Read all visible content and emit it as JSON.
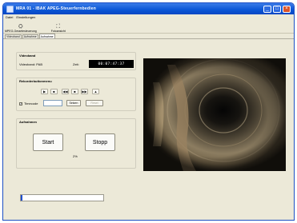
{
  "window": {
    "title": "MRA 01 - IBAK APEG-Steuerfernbedien",
    "controls": {
      "minimize": "_",
      "maximize": "□",
      "close": "×"
    }
  },
  "menu": [
    "Datei",
    "Einstellungen"
  ],
  "toolbar": [
    {
      "label": "MPEG-Geraetesteuerung",
      "icon": "camera-icon"
    },
    {
      "label": "Fotoansicht",
      "icon": "photo-icon"
    }
  ],
  "tabs": [
    {
      "label": "Videoband",
      "active": false
    },
    {
      "label": "Aufnahme",
      "active": false
    },
    {
      "label": "Aufnahme",
      "active": true
    }
  ],
  "video_section": {
    "title": "Videoband",
    "videoband_label": "Videoband: PAB",
    "zeit_label": "Zeit:",
    "zeit_value": "00:07:47:37"
  },
  "recorder": {
    "title": "Rekorderbuttonmenu",
    "buttons": [
      {
        "symbol": "▶",
        "name": "play"
      },
      {
        "symbol": "■",
        "name": "stop"
      },
      {
        "symbol": "◀◀",
        "name": "rewind"
      },
      {
        "symbol": "■",
        "name": "pause"
      },
      {
        "symbol": "▶▶",
        "name": "fast-forward"
      },
      {
        "symbol": "▲",
        "name": "eject"
      }
    ],
    "timecode_label": "Timecode",
    "timecode_checked": true,
    "timecode_value": "",
    "setzen_label": "Setzen",
    "reset_label": "Reset"
  },
  "capture": {
    "title": "Aufnahmen",
    "start_label": "Start",
    "stop_label": "Stopp",
    "progress_percent": 2,
    "progress_text": "2%"
  },
  "colors": {
    "title_bar": "#0a56d6",
    "window_bg": "#ece9d8",
    "progress_fill": "#1f4fd0",
    "lcd_bg": "#000000"
  }
}
